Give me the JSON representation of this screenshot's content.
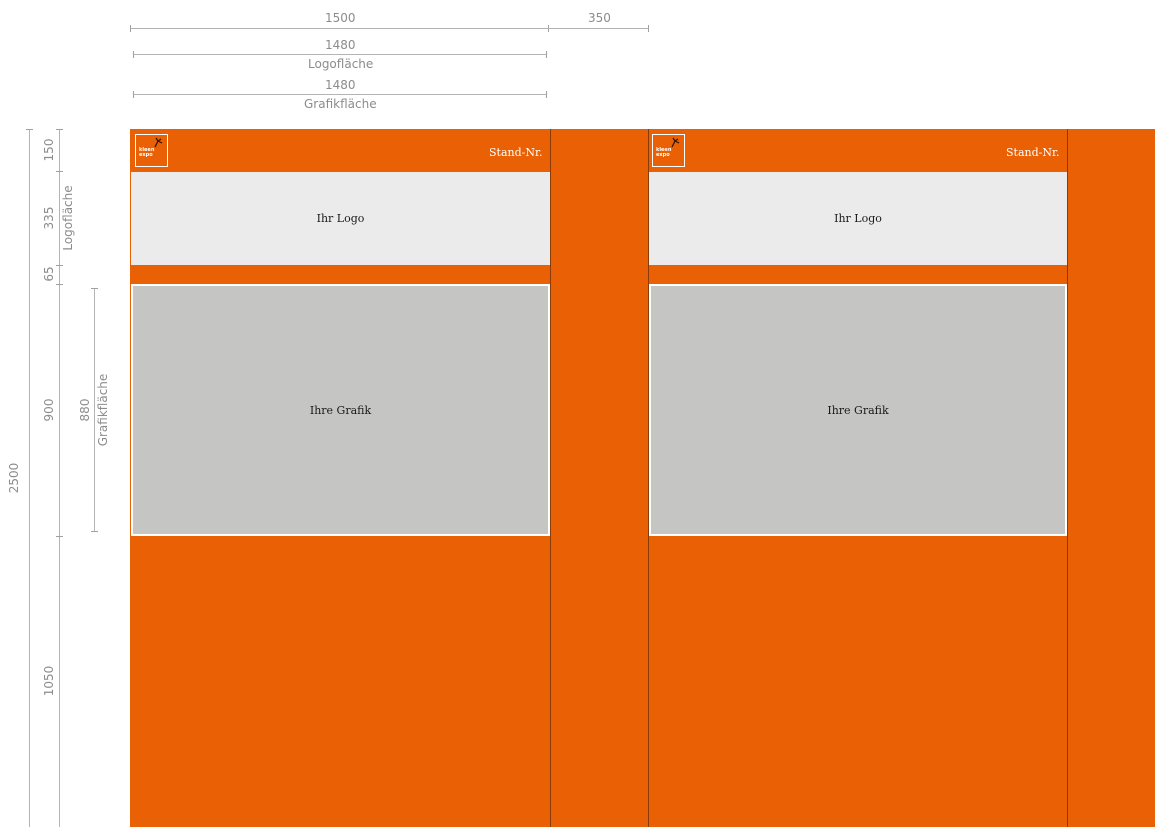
{
  "dimensions": {
    "top": {
      "total_width": "1500",
      "gap_width": "350",
      "logo_width": "1480",
      "logo_label": "Logofläche",
      "grafik_width": "1480",
      "grafik_label": "Grafikfläche"
    },
    "left": {
      "total_height": "2500",
      "header_height": "150",
      "logo_height": "335",
      "logo_label": "Logofläche",
      "spacer_height": "65",
      "grafik_outer_height": "900",
      "grafik_height": "880",
      "grafik_label": "Grafikfläche",
      "bottom_height": "1050"
    }
  },
  "panels": [
    {
      "stand_label": "Stand-Nr.",
      "logo_label": "Ihr Logo",
      "grafik_label": "Ihre Grafik",
      "brand_text": [
        "kleen",
        "expo"
      ]
    },
    {
      "stand_label": "Stand-Nr.",
      "logo_label": "Ihr Logo",
      "grafik_label": "Ihre Grafik",
      "brand_text": [
        "kleen",
        "expo"
      ]
    }
  ],
  "colors": {
    "panel_orange": "#ea6004",
    "logo_area": "#ebebeb",
    "grafik_area": "#c5c6c4",
    "dimension_gray": "#8c8c8c"
  }
}
